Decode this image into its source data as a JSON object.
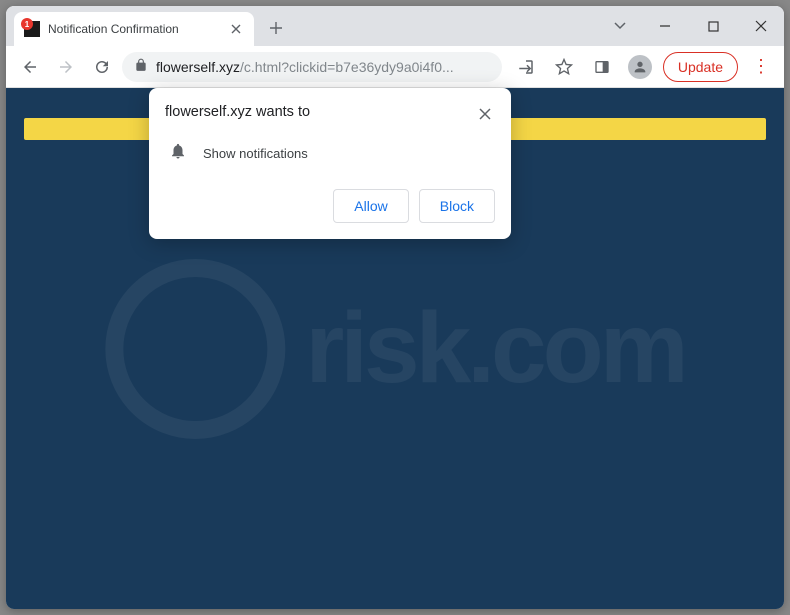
{
  "tab": {
    "title": "Notification Confirmation",
    "badge": "1"
  },
  "url": {
    "host": "flowerself.xyz",
    "path": "/c.html?clickid=b7e36ydy9a0i4f0..."
  },
  "toolbar": {
    "update_label": "Update"
  },
  "dialog": {
    "title": "flowerself.xyz wants to",
    "body": "Show notifications",
    "allow": "Allow",
    "block": "Block"
  },
  "watermark": {
    "text": "risk.com"
  }
}
